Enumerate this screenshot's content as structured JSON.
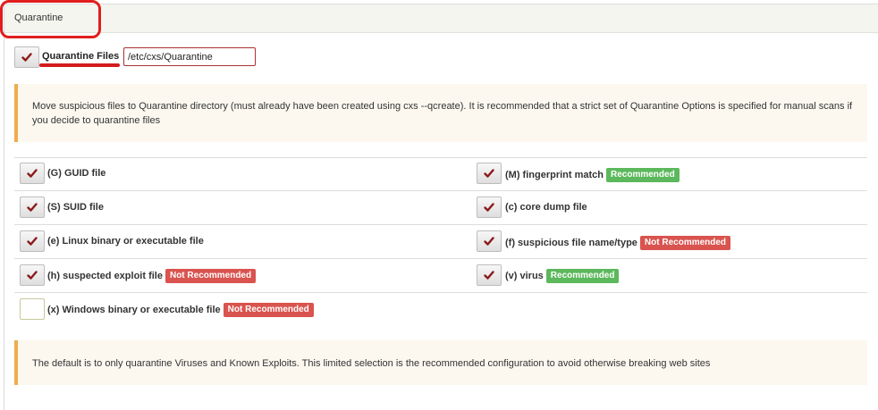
{
  "section": {
    "title": "Quarantine"
  },
  "quarantine": {
    "label": "Quarantine Files",
    "checked": true,
    "path_value": "/etc/cxs/Quarantine"
  },
  "notes": {
    "top": "Move suspicious files to Quarantine directory (must already have been created using cxs --qcreate). It is recommended that a strict set of Quarantine Options is specified for manual scans if you decide to quarantine files",
    "bottom": "The default is to only quarantine Viruses and Known Exploits. This limited selection is the recommended configuration to avoid otherwise breaking web sites"
  },
  "options": [
    {
      "label": "(G) GUID file",
      "checked": true,
      "badge": ""
    },
    {
      "label": "(M) fingerprint match",
      "checked": true,
      "badge": "Recommended",
      "badge_type": "green"
    },
    {
      "label": "(S) SUID file",
      "checked": true,
      "badge": ""
    },
    {
      "label": "(c) core dump file",
      "checked": true,
      "badge": ""
    },
    {
      "label": "(e) Linux binary or executable file",
      "checked": true,
      "badge": ""
    },
    {
      "label": "(f) suspicious file name/type",
      "checked": true,
      "badge": "Not Recommended",
      "badge_type": "red"
    },
    {
      "label": "(h) suspected exploit file",
      "checked": true,
      "badge": "Not Recommended",
      "badge_type": "red"
    },
    {
      "label": "(v) virus",
      "checked": true,
      "badge": "Recommended",
      "badge_type": "green"
    },
    {
      "label": "(x) Windows binary or executable file",
      "checked": false,
      "badge": "Not Recommended",
      "badge_type": "red"
    }
  ],
  "colors": {
    "check_mark": "#8b1a1a",
    "highlight": "#e01e1e",
    "badge_green": "#5cb85c",
    "badge_red": "#d9534f",
    "note_border": "#f0ad4e"
  },
  "icons": {
    "check": "check-icon"
  }
}
